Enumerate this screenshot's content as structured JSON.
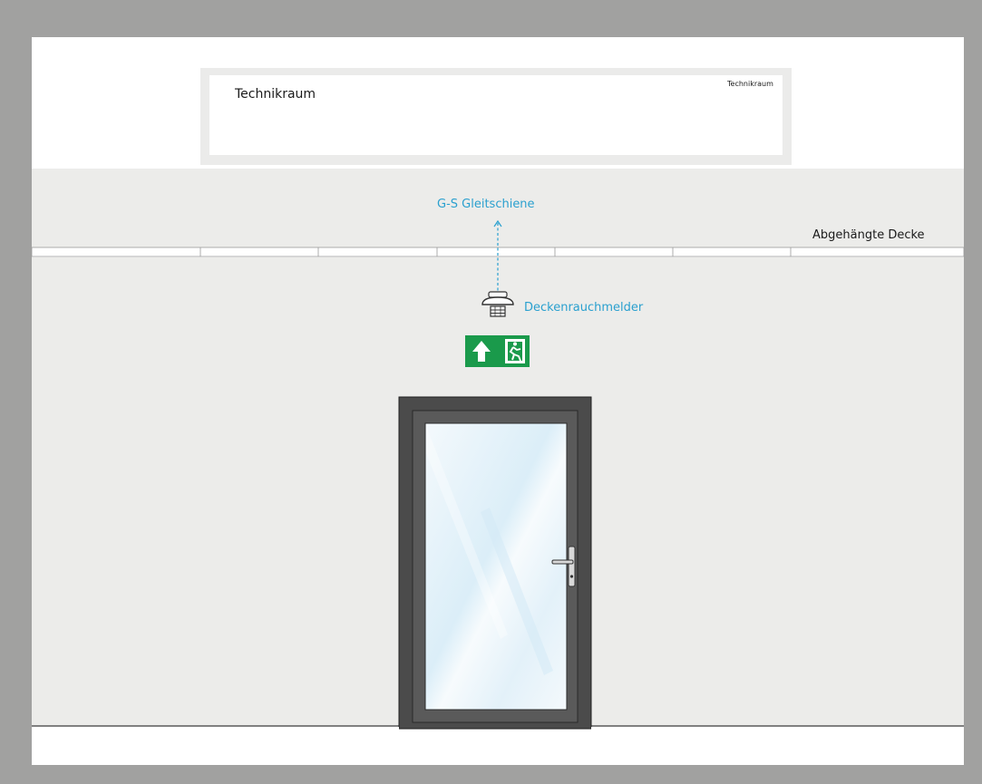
{
  "sign": {
    "title": "Technikraum",
    "small_title": "Technikraum"
  },
  "labels": {
    "rail": "G-S Gleitschiene",
    "ceiling": "Abgehängte Decke",
    "smoke_detector": "Deckenrauchmelder"
  },
  "colors": {
    "frame": "#a1a1a0",
    "paper": "#ffffff",
    "wall": "#ececea",
    "door_frame": "#4a4a4a",
    "glass": "#eef6fb",
    "annotation": "#2aa0cf",
    "exit_sign": "#1a9a4b"
  },
  "icons": {
    "exit_sign": "emergency-exit-sign-icon",
    "smoke_detector": "smoke-detector-icon",
    "door_handle": "door-handle-icon"
  }
}
